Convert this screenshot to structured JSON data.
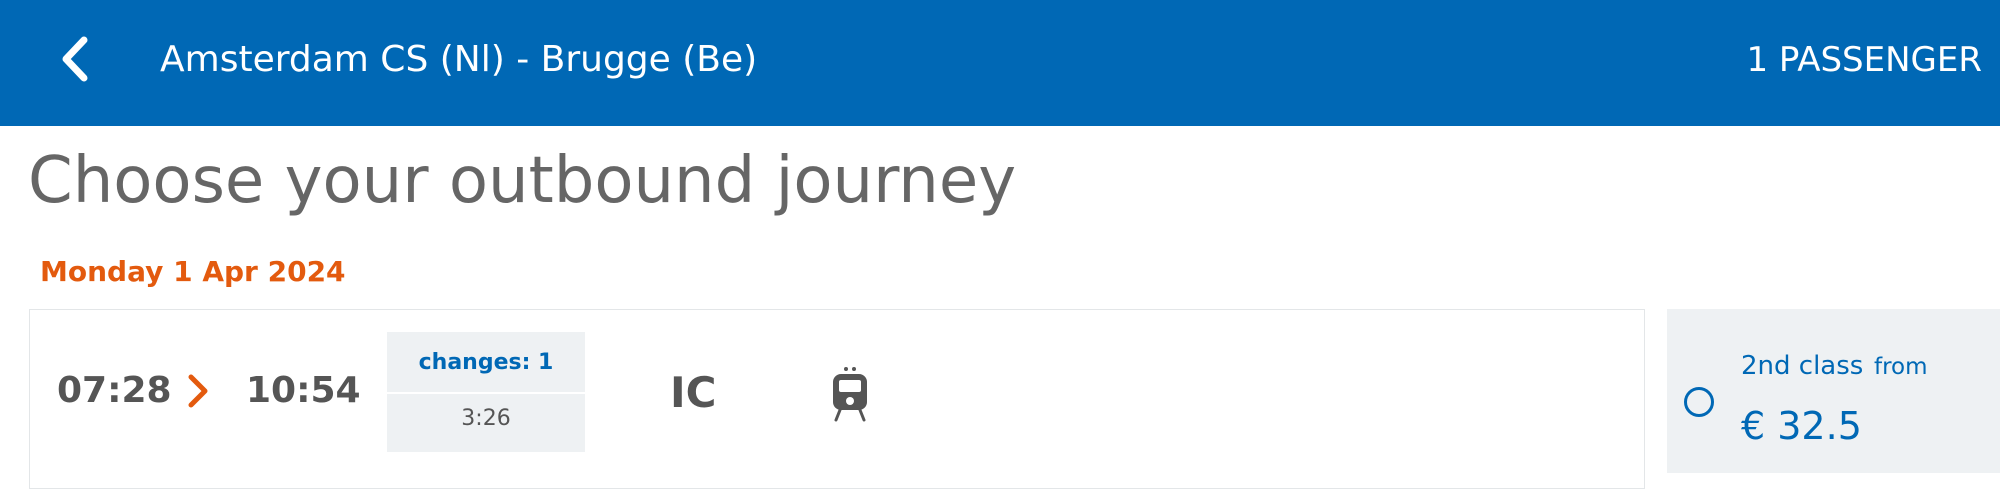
{
  "header": {
    "route": "Amsterdam CS (Nl) - Brugge (Be)",
    "passengers": "1 PASSENGER",
    "back_icon": "chevron-left-icon"
  },
  "page": {
    "title": "Choose your outbound journey",
    "date": "Monday 1 Apr 2024"
  },
  "journey": {
    "departure": "07:28",
    "arrival": "10:54",
    "changes": "changes: 1",
    "duration": "3:26",
    "train_type": "IC",
    "arrow_icon": "chevron-right-icon",
    "train_icon": "train-icon"
  },
  "fare": {
    "class": "2nd class",
    "from": "from",
    "price": "€ 32.5",
    "selected": false
  },
  "colors": {
    "brand_blue": "#0068b5",
    "accent_orange": "#e35a0e",
    "panel_grey": "#eef1f3",
    "text_grey": "#555555"
  }
}
